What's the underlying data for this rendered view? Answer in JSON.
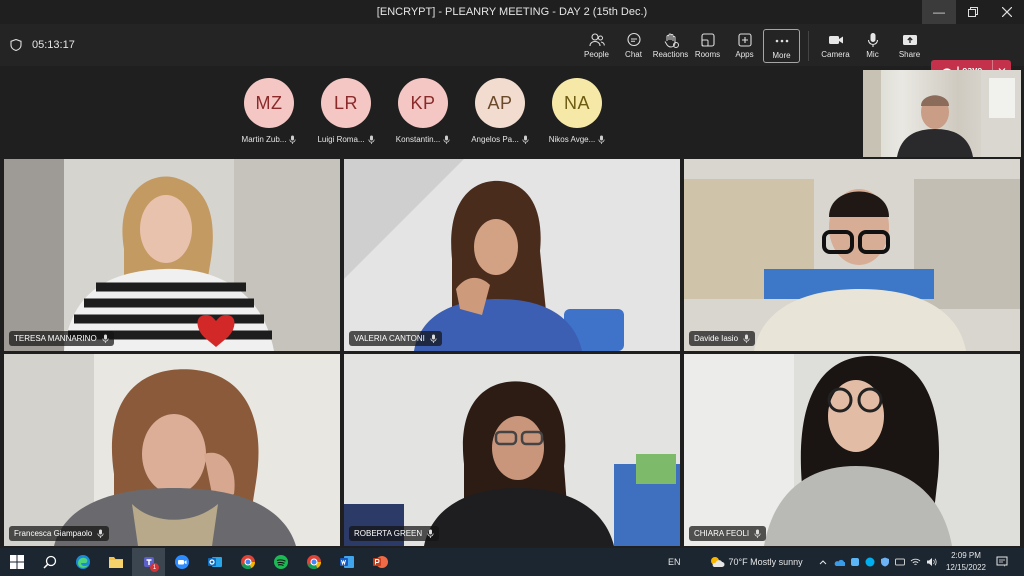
{
  "window": {
    "title": "[ENCRYPT] - PLEANRY MEETING - DAY 2 (15th Dec.)"
  },
  "meeting": {
    "timer": "05:13:17"
  },
  "toolbar": {
    "people": "People",
    "chat": "Chat",
    "reactions": "Reactions",
    "rooms": "Rooms",
    "apps": "Apps",
    "more": "More",
    "camera": "Camera",
    "mic": "Mic",
    "share": "Share",
    "leave": "Leave"
  },
  "participants": [
    {
      "initials": "MZ",
      "name": "Martin Zub...",
      "bg": "#f4c7c4",
      "fg": "#8a2a2a"
    },
    {
      "initials": "LR",
      "name": "Luigi Roma...",
      "bg": "#f4c7c4",
      "fg": "#8a2a2a"
    },
    {
      "initials": "KP",
      "name": "Konstantin...",
      "bg": "#f4c7c4",
      "fg": "#8a2a2a"
    },
    {
      "initials": "AP",
      "name": "Angelos Pa...",
      "bg": "#f2dccf",
      "fg": "#6b4a2a"
    },
    {
      "initials": "NA",
      "name": "Nikos Avge...",
      "bg": "#f6e9a8",
      "fg": "#6e5b12"
    }
  ],
  "videos": [
    {
      "name": "TERESA MANNARINO"
    },
    {
      "name": "VALERIA CANTONI"
    },
    {
      "name": "Davide Iasio"
    },
    {
      "name": "Francesca Giampaolo"
    },
    {
      "name": "ROBERTA GREEN"
    },
    {
      "name": "CHIARA FEOLI"
    }
  ],
  "taskbar": {
    "language": "EN",
    "weather": "70°F  Mostly sunny",
    "time": "2:09 PM",
    "date": "12/15/2022",
    "teams_badge": "1"
  },
  "colors": {
    "leave": "#c4314b",
    "toolbar_bg": "#242424",
    "taskbar_bg": "#1c2630"
  }
}
